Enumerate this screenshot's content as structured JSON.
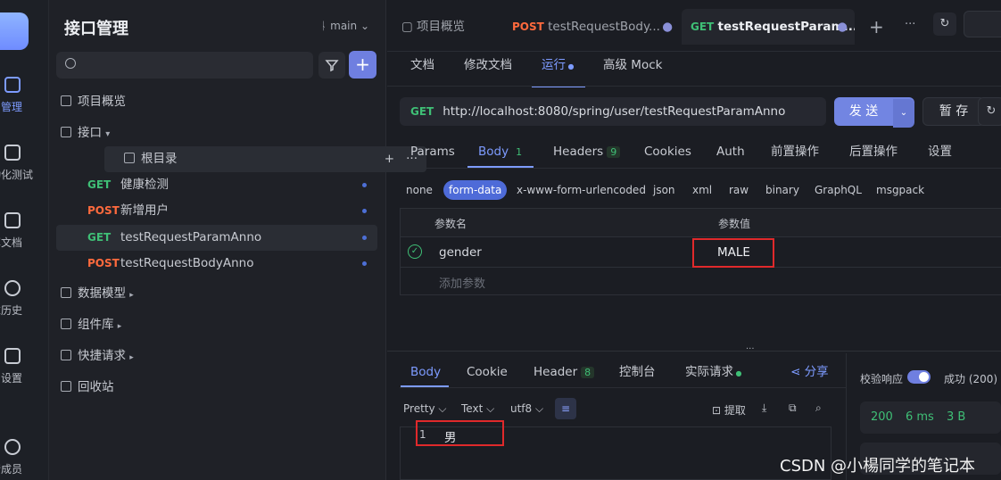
{
  "rail": {
    "items": [
      {
        "label": "口管理"
      },
      {
        "label": "动化测试"
      },
      {
        "label": "享文档"
      },
      {
        "label": "求历史"
      },
      {
        "label": "目设置"
      },
      {
        "label": "请成员"
      }
    ]
  },
  "sidebar": {
    "title": "接口管理",
    "branch": "main",
    "nav": {
      "overview": "项目概览",
      "interfaces": "接口",
      "root": "根目录",
      "data_models": "数据模型",
      "components": "组件库",
      "quick_requests": "快捷请求",
      "trash": "回收站"
    },
    "endpoints": [
      {
        "method": "GET",
        "name": "健康检测"
      },
      {
        "method": "POST",
        "name": "新增用户"
      },
      {
        "method": "GET",
        "name": "testRequestParamAnno"
      },
      {
        "method": "POST",
        "name": "testRequestBodyAnno"
      }
    ]
  },
  "tabs": [
    {
      "label": "项目概览"
    },
    {
      "method": "POST",
      "label": "testRequestBody..."
    },
    {
      "method": "GET",
      "label": "testRequestParam..."
    }
  ],
  "subtabs": [
    "文档",
    "修改文档",
    "运行",
    "高级 Mock"
  ],
  "request": {
    "method": "GET",
    "url": "http://localhost:8080/spring/user/testRequestParamAnno",
    "send_label": "发 送",
    "save_label": "暂 存"
  },
  "param_tabs": [
    {
      "label": "Params"
    },
    {
      "label": "Body",
      "count": "1"
    },
    {
      "label": "Headers",
      "count": "9"
    },
    {
      "label": "Cookies"
    },
    {
      "label": "Auth"
    },
    {
      "label": "前置操作"
    },
    {
      "label": "后置操作"
    },
    {
      "label": "设置"
    }
  ],
  "body_types": [
    "none",
    "form-data",
    "x-www-form-urlencoded",
    "json",
    "xml",
    "raw",
    "binary",
    "GraphQL",
    "msgpack"
  ],
  "params_table": {
    "col_name": "参数名",
    "col_value": "参数值",
    "rows": [
      {
        "name": "gender",
        "value": "MALE"
      }
    ],
    "add_placeholder": "添加参数"
  },
  "response": {
    "tabs": [
      {
        "label": "Body"
      },
      {
        "label": "Cookie"
      },
      {
        "label": "Header",
        "count": "8"
      },
      {
        "label": "控制台"
      },
      {
        "label": "实际请求"
      }
    ],
    "share": "分享",
    "toolbar": {
      "pretty": "Pretty",
      "text": "Text",
      "encoding": "utf8",
      "extract": "提取"
    },
    "lines": [
      {
        "no": "1",
        "text": "男"
      }
    ],
    "validate_label": "校验响应",
    "result": "成功 (200)",
    "status": "200",
    "time": "6 ms",
    "size": "3 B"
  },
  "watermark": "CSDN @小楊同学的笔记本",
  "colors": {
    "accent": "#7d9bff",
    "get": "#3fbf76",
    "post": "#ff6a3d",
    "highlight": "#e0292b"
  }
}
